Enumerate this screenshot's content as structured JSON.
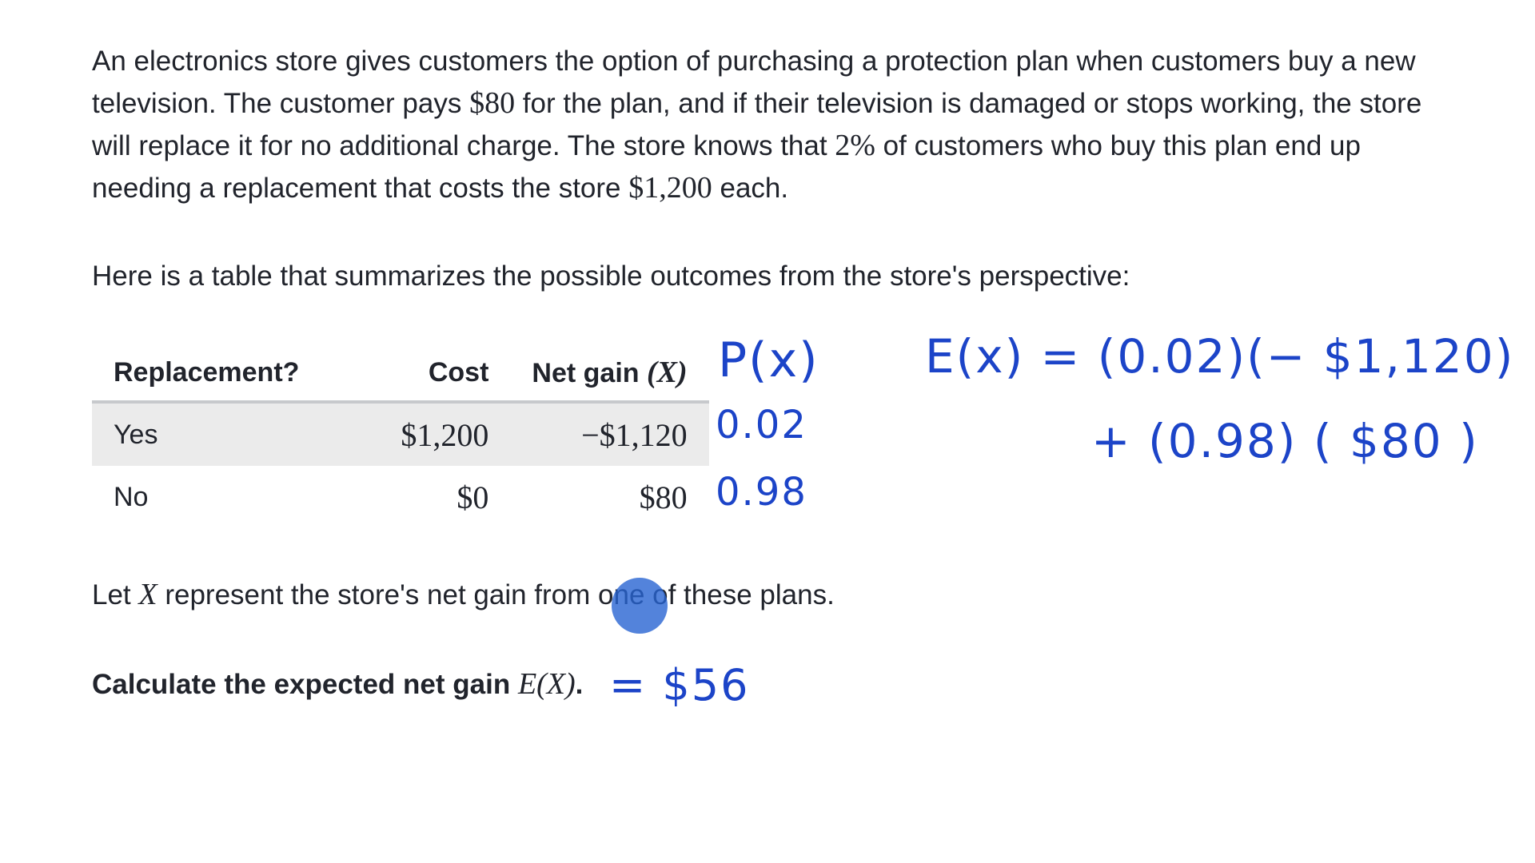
{
  "problem": {
    "intro_1": "An electronics store gives customers the option of purchasing a protection plan when customers buy a new television. The customer pays ",
    "plan_price": "$80",
    "intro_2": " for the plan, and if their television is damaged or stops working, the store will replace it for no additional charge. The store knows that ",
    "percent": "2%",
    "intro_3": " of customers who buy this plan end up needing a replacement that costs the store ",
    "replacement_cost": "$1,200",
    "intro_4": " each.",
    "table_intro": "Here is a table that summarizes the possible outcomes from the store's perspective:",
    "let_x_1": "Let ",
    "variable": "X",
    "let_x_2": " represent the store's net gain from one of these plans.",
    "question_text": "Calculate the expected net gain ",
    "question_math": "E(X)",
    "question_end": "."
  },
  "table": {
    "headers": {
      "replacement": "Replacement?",
      "cost": "Cost",
      "net_gain": "Net gain ",
      "net_gain_var": "(X)"
    },
    "rows": [
      {
        "replacement": "Yes",
        "cost": "$1,200",
        "net_gain": "−$1,120"
      },
      {
        "replacement": "No",
        "cost": "$0",
        "net_gain": "$80"
      }
    ]
  },
  "handwriting": {
    "px_label": "P(x)",
    "p_yes": "0.02",
    "p_no": "0.98",
    "expectation_line1": "E(x) = (0.02)(− $1,120)",
    "expectation_line2": "+ (0.98) ( $80 )",
    "answer": "= $56"
  },
  "colors": {
    "ink": "#1c44c8",
    "cursor": "#2864d2",
    "row_shade": "#ebebeb",
    "header_rule": "#c7c9cc"
  }
}
